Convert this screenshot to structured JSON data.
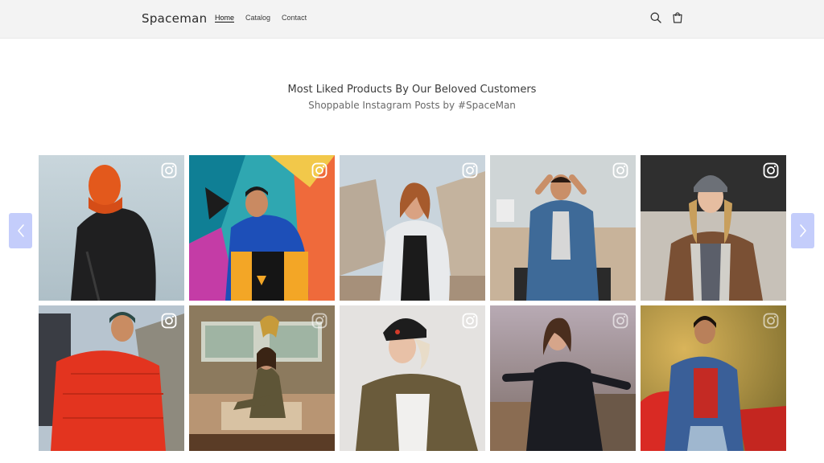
{
  "header": {
    "logo": "Spaceman",
    "nav": [
      {
        "label": "Home",
        "active": true
      },
      {
        "label": "Catalog",
        "active": false
      },
      {
        "label": "Contact",
        "active": false
      }
    ],
    "icons": [
      "search-icon",
      "cart-icon"
    ]
  },
  "section": {
    "title": "Most Liked Products By Our Beloved Customers",
    "subtitle": "Shoppable Instagram Posts by #SpaceMan"
  },
  "carousel": {
    "prev_icon": "chevron-left-icon",
    "next_icon": "chevron-right-icon",
    "accent_color": "#c4cdfb"
  },
  "posts": [
    {
      "subject": "man-orange-balaclava-black-jacket",
      "icon": "instagram-icon"
    },
    {
      "subject": "man-colorblock-jacket-graffiti-wall",
      "icon": "instagram-icon"
    },
    {
      "subject": "woman-white-puffer-concrete-blocks",
      "icon": "instagram-icon"
    },
    {
      "subject": "man-denim-jacket-beach",
      "icon": "instagram-icon"
    },
    {
      "subject": "woman-beanie-shearling-jacket",
      "icon": "instagram-icon"
    },
    {
      "subject": "man-red-puffer-backpack",
      "icon": "instagram-icon"
    },
    {
      "subject": "woman-camo-dress-van-interior",
      "icon": "instagram-icon"
    },
    {
      "subject": "woman-beanie-olive-jacket",
      "icon": "instagram-icon"
    },
    {
      "subject": "woman-leather-jacket-rooftop",
      "icon": "instagram-icon"
    },
    {
      "subject": "man-denim-jacket-red-car",
      "icon": "instagram-icon"
    }
  ]
}
